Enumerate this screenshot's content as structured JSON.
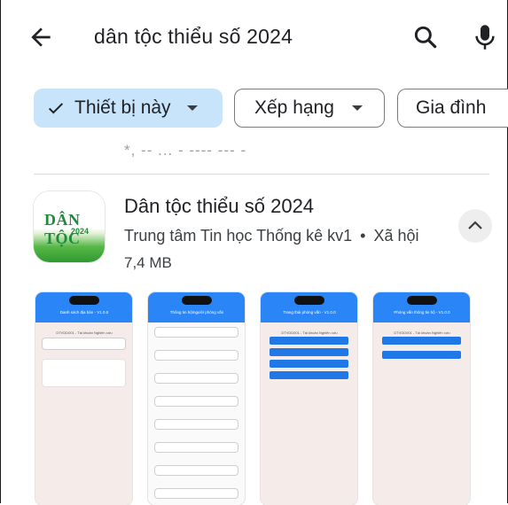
{
  "search": {
    "query": "dân tộc thiểu số 2024",
    "back_icon": "arrow-back-icon",
    "search_icon": "search-icon",
    "mic_icon": "microphone-icon"
  },
  "filters": [
    {
      "label": "Thiết bị này",
      "selected": true,
      "has_dropdown": true
    },
    {
      "label": "Xếp hạng",
      "selected": false,
      "has_dropdown": true
    },
    {
      "label": "Gia đình",
      "selected": false,
      "has_dropdown": false
    }
  ],
  "previous_result_peek": "*,   -- ...   -   ----  --- -",
  "app": {
    "icon_text": "DÂN TỘC",
    "icon_subtext": "2024",
    "title": "Dân tộc thiểu số 2024",
    "developer": "Trung tâm Tin học Thống kê kv1",
    "separator": "•",
    "category": "Xã hội",
    "size": "7,4 MB",
    "collapse_icon": "chevron-up-icon"
  },
  "screenshots": [
    {
      "title": "Danh sách địa bàn - V1.0.0",
      "subtitle": "DTVDD001 - Tài khoản Nghiên cứu"
    },
    {
      "title": "Thông tin hộ/người phỏng vấn",
      "subtitle": ""
    },
    {
      "title": "Trang thái phỏng vấn - V1.0.0",
      "subtitle": "DTVDD001 - Tài khoản Nghiên cứu"
    },
    {
      "title": "Phỏng vấn thông tin hộ - V1.0.0",
      "subtitle": "DTVDD001 - Tài khoản Nghiên cứu"
    }
  ],
  "colors": {
    "chip_selected_bg": "#c7e4fb",
    "accent_blue": "#2a86f6",
    "icon_green": "#2e9a2f"
  }
}
